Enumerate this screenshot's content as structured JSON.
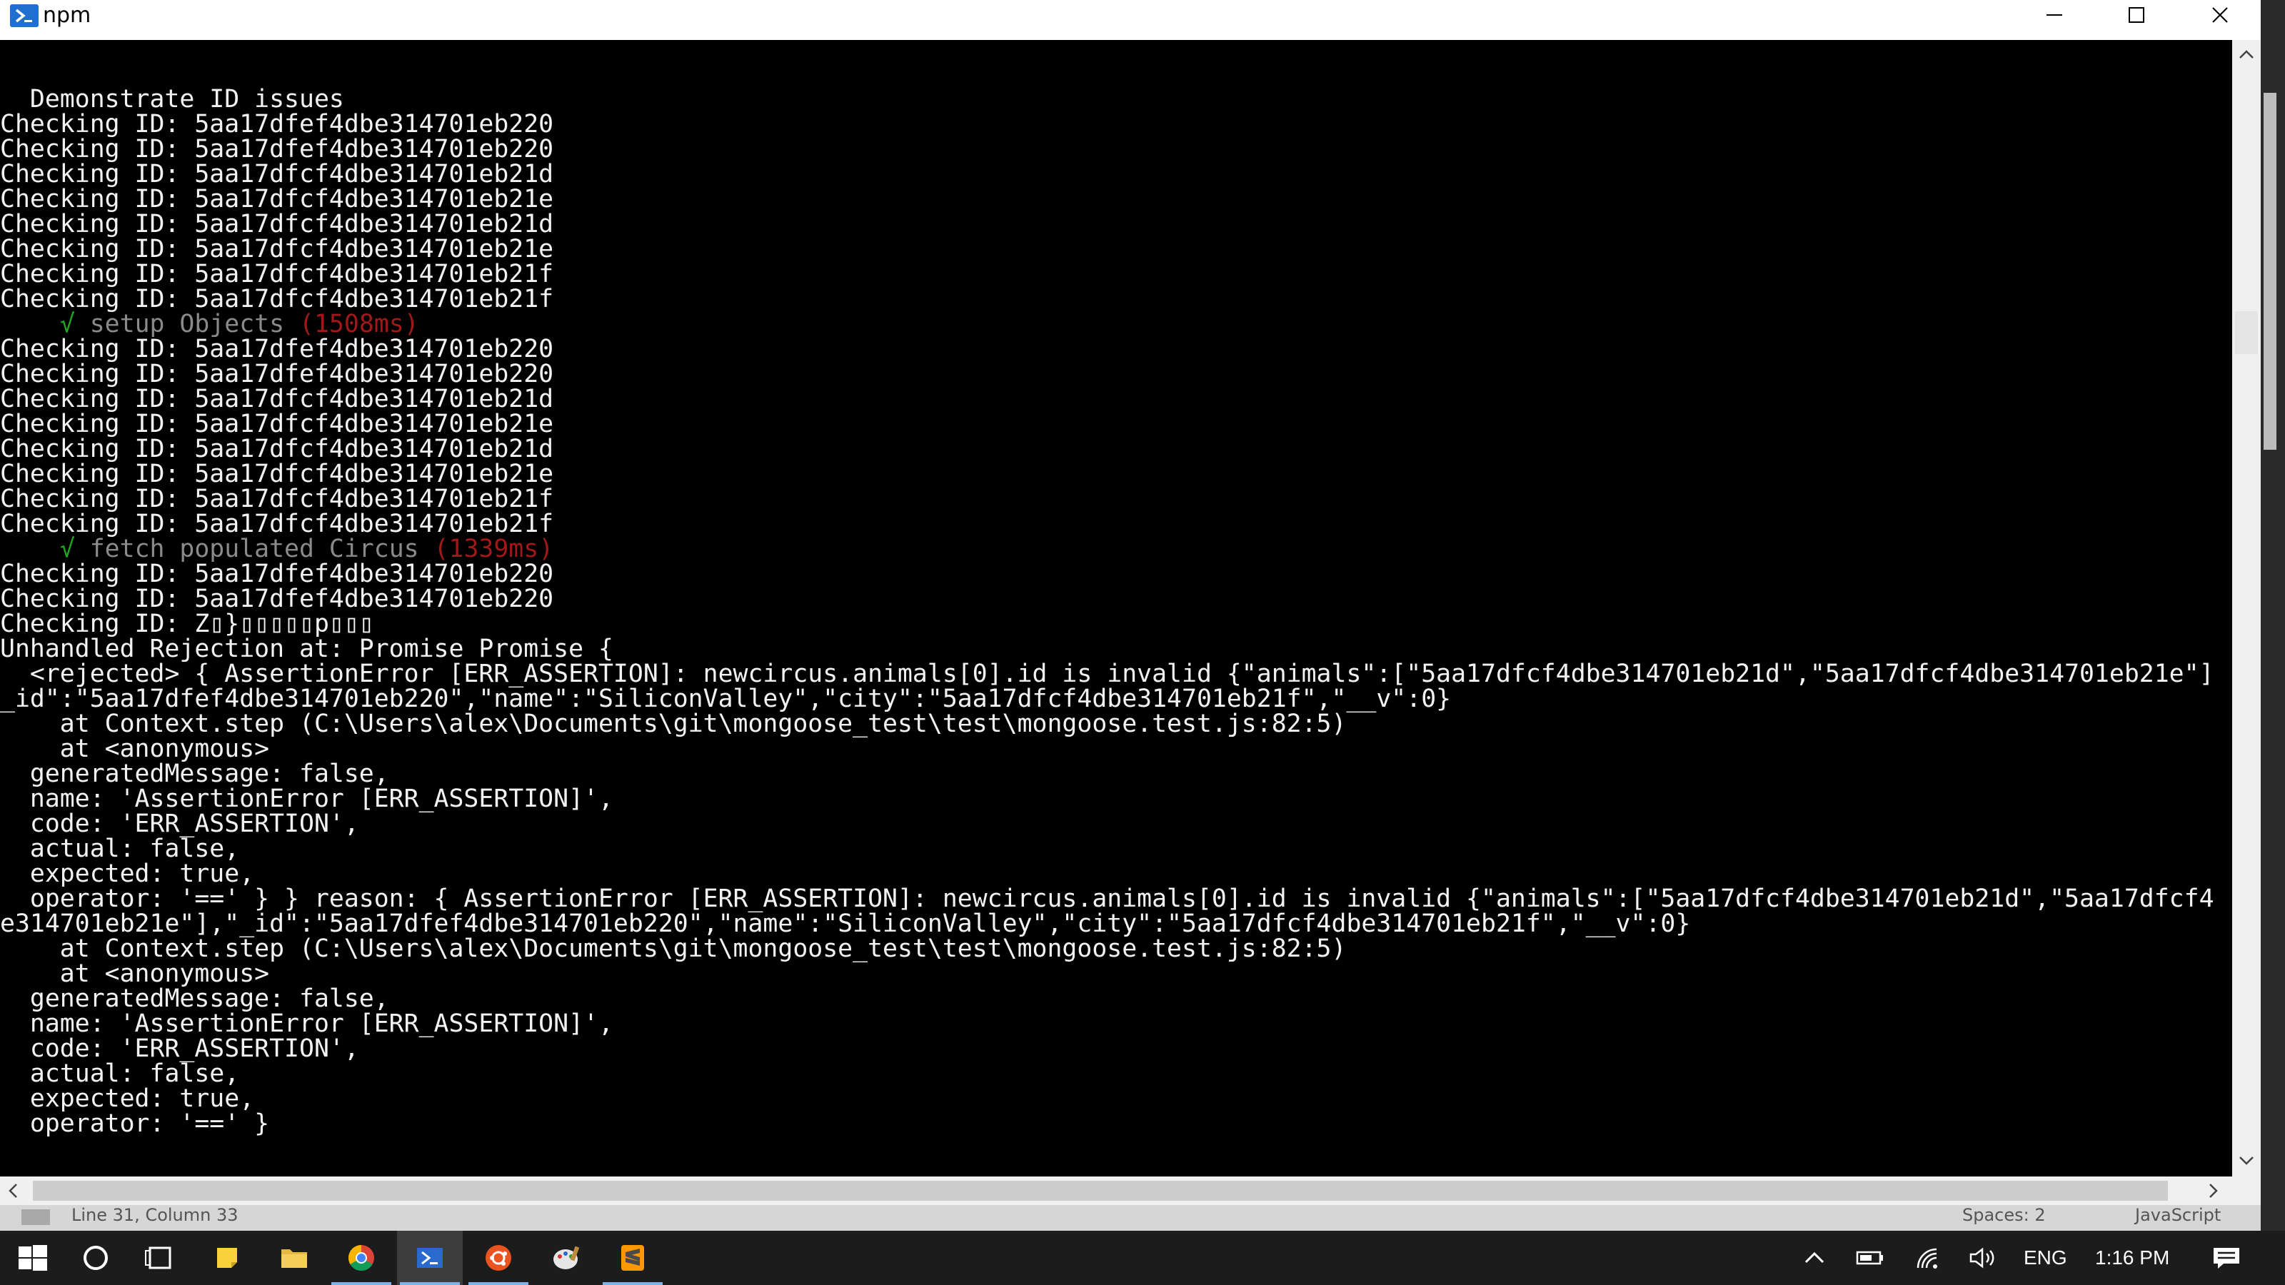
{
  "window": {
    "title": "npm"
  },
  "terminal": {
    "lines": [
      {
        "segments": [
          {
            "text": "  Demonstrate ID issues",
            "color": "white"
          }
        ]
      },
      {
        "segments": [
          {
            "text": "Checking ID: 5aa17dfef4dbe314701eb220",
            "color": "white"
          }
        ]
      },
      {
        "segments": [
          {
            "text": "Checking ID: 5aa17dfef4dbe314701eb220",
            "color": "white"
          }
        ]
      },
      {
        "segments": [
          {
            "text": "Checking ID: 5aa17dfcf4dbe314701eb21d",
            "color": "white"
          }
        ]
      },
      {
        "segments": [
          {
            "text": "Checking ID: 5aa17dfcf4dbe314701eb21e",
            "color": "white"
          }
        ]
      },
      {
        "segments": [
          {
            "text": "Checking ID: 5aa17dfcf4dbe314701eb21d",
            "color": "white"
          }
        ]
      },
      {
        "segments": [
          {
            "text": "Checking ID: 5aa17dfcf4dbe314701eb21e",
            "color": "white"
          }
        ]
      },
      {
        "segments": [
          {
            "text": "Checking ID: 5aa17dfcf4dbe314701eb21f",
            "color": "white"
          }
        ]
      },
      {
        "segments": [
          {
            "text": "Checking ID: 5aa17dfcf4dbe314701eb21f",
            "color": "white"
          }
        ]
      },
      {
        "segments": [
          {
            "text": "    ",
            "color": "white"
          },
          {
            "text": "√",
            "color": "green"
          },
          {
            "text": " setup Objects ",
            "color": "gray"
          },
          {
            "text": "(1508ms)",
            "color": "red"
          }
        ]
      },
      {
        "segments": [
          {
            "text": "Checking ID: 5aa17dfef4dbe314701eb220",
            "color": "white"
          }
        ]
      },
      {
        "segments": [
          {
            "text": "Checking ID: 5aa17dfef4dbe314701eb220",
            "color": "white"
          }
        ]
      },
      {
        "segments": [
          {
            "text": "Checking ID: 5aa17dfcf4dbe314701eb21d",
            "color": "white"
          }
        ]
      },
      {
        "segments": [
          {
            "text": "Checking ID: 5aa17dfcf4dbe314701eb21e",
            "color": "white"
          }
        ]
      },
      {
        "segments": [
          {
            "text": "Checking ID: 5aa17dfcf4dbe314701eb21d",
            "color": "white"
          }
        ]
      },
      {
        "segments": [
          {
            "text": "Checking ID: 5aa17dfcf4dbe314701eb21e",
            "color": "white"
          }
        ]
      },
      {
        "segments": [
          {
            "text": "Checking ID: 5aa17dfcf4dbe314701eb21f",
            "color": "white"
          }
        ]
      },
      {
        "segments": [
          {
            "text": "Checking ID: 5aa17dfcf4dbe314701eb21f",
            "color": "white"
          }
        ]
      },
      {
        "segments": [
          {
            "text": "    ",
            "color": "white"
          },
          {
            "text": "√",
            "color": "green"
          },
          {
            "text": " fetch populated Circus ",
            "color": "gray"
          },
          {
            "text": "(1339ms)",
            "color": "red"
          }
        ]
      },
      {
        "segments": [
          {
            "text": "Checking ID: 5aa17dfef4dbe314701eb220",
            "color": "white"
          }
        ]
      },
      {
        "segments": [
          {
            "text": "Checking ID: 5aa17dfef4dbe314701eb220",
            "color": "white"
          }
        ]
      },
      {
        "segments": [
          {
            "text": "Checking ID: Z▯}▯▯▯▯▯p▯▯▯",
            "color": "white"
          }
        ]
      },
      {
        "segments": [
          {
            "text": "Unhandled Rejection at: Promise Promise {",
            "color": "white"
          }
        ]
      },
      {
        "segments": [
          {
            "text": "  <rejected> { AssertionError [ERR_ASSERTION]: newcircus.animals[0].id is invalid {\"animals\":[\"5aa17dfcf4dbe314701eb21d\",\"5aa17dfcf4dbe314701eb21e\"]",
            "color": "white"
          }
        ]
      },
      {
        "segments": [
          {
            "text": "_id\":\"5aa17dfef4dbe314701eb220\",\"name\":\"SiliconValley\",\"city\":\"5aa17dfcf4dbe314701eb21f\",\"__v\":0}",
            "color": "white"
          }
        ]
      },
      {
        "segments": [
          {
            "text": "    at Context.step (C:\\Users\\alex\\Documents\\git\\mongoose_test\\test\\mongoose.test.js:82:5)",
            "color": "white"
          }
        ]
      },
      {
        "segments": [
          {
            "text": "    at <anonymous>",
            "color": "white"
          }
        ]
      },
      {
        "segments": [
          {
            "text": "  generatedMessage: false,",
            "color": "white"
          }
        ]
      },
      {
        "segments": [
          {
            "text": "  name: 'AssertionError [ERR_ASSERTION]',",
            "color": "white"
          }
        ]
      },
      {
        "segments": [
          {
            "text": "  code: 'ERR_ASSERTION',",
            "color": "white"
          }
        ]
      },
      {
        "segments": [
          {
            "text": "  actual: false,",
            "color": "white"
          }
        ]
      },
      {
        "segments": [
          {
            "text": "  expected: true,",
            "color": "white"
          }
        ]
      },
      {
        "segments": [
          {
            "text": "  operator: '==' } } reason: { AssertionError [ERR_ASSERTION]: newcircus.animals[0].id is invalid {\"animals\":[\"5aa17dfcf4dbe314701eb21d\",\"5aa17dfcf4",
            "color": "white"
          }
        ]
      },
      {
        "segments": [
          {
            "text": "e314701eb21e\"],\"_id\":\"5aa17dfef4dbe314701eb220\",\"name\":\"SiliconValley\",\"city\":\"5aa17dfcf4dbe314701eb21f\",\"__v\":0}",
            "color": "white"
          }
        ]
      },
      {
        "segments": [
          {
            "text": "    at Context.step (C:\\Users\\alex\\Documents\\git\\mongoose_test\\test\\mongoose.test.js:82:5)",
            "color": "white"
          }
        ]
      },
      {
        "segments": [
          {
            "text": "    at <anonymous>",
            "color": "white"
          }
        ]
      },
      {
        "segments": [
          {
            "text": "  generatedMessage: false,",
            "color": "white"
          }
        ]
      },
      {
        "segments": [
          {
            "text": "  name: 'AssertionError [ERR_ASSERTION]',",
            "color": "white"
          }
        ]
      },
      {
        "segments": [
          {
            "text": "  code: 'ERR_ASSERTION',",
            "color": "white"
          }
        ]
      },
      {
        "segments": [
          {
            "text": "  actual: false,",
            "color": "white"
          }
        ]
      },
      {
        "segments": [
          {
            "text": "  expected: true,",
            "color": "white"
          }
        ]
      },
      {
        "segments": [
          {
            "text": "  operator: '==' }",
            "color": "white"
          }
        ]
      }
    ]
  },
  "editor_status": {
    "position": "Line 31, Column 33",
    "spaces": "Spaces: 2",
    "language": "JavaScript"
  },
  "taskbar": {
    "items": [
      {
        "name": "start-button",
        "icon": "windows-logo-icon"
      },
      {
        "name": "search-button",
        "icon": "cortana-circle-icon"
      },
      {
        "name": "task-view-button",
        "icon": "task-view-icon"
      },
      {
        "name": "sticky-notes-button",
        "icon": "sticky-notes-icon"
      },
      {
        "name": "file-explorer-button",
        "icon": "folder-icon"
      },
      {
        "name": "chrome-button",
        "icon": "chrome-icon"
      },
      {
        "name": "powershell-button",
        "icon": "powershell-icon",
        "active": true
      },
      {
        "name": "ubuntu-button",
        "icon": "ubuntu-icon"
      },
      {
        "name": "paint-button",
        "icon": "paint-icon"
      },
      {
        "name": "sublime-button",
        "icon": "sublime-text-icon"
      }
    ],
    "tray": {
      "language": "ENG",
      "time": "1:16 PM"
    }
  },
  "colors": {
    "terminal_bg": "#000000",
    "text": "#f2f2f2",
    "test_pass_mark": "#1fa81f",
    "test_name": "#8a8a8a",
    "duration": "#a01818",
    "taskbar_bg": "#1c1c1c",
    "active_underline": "#7fb3e8"
  }
}
